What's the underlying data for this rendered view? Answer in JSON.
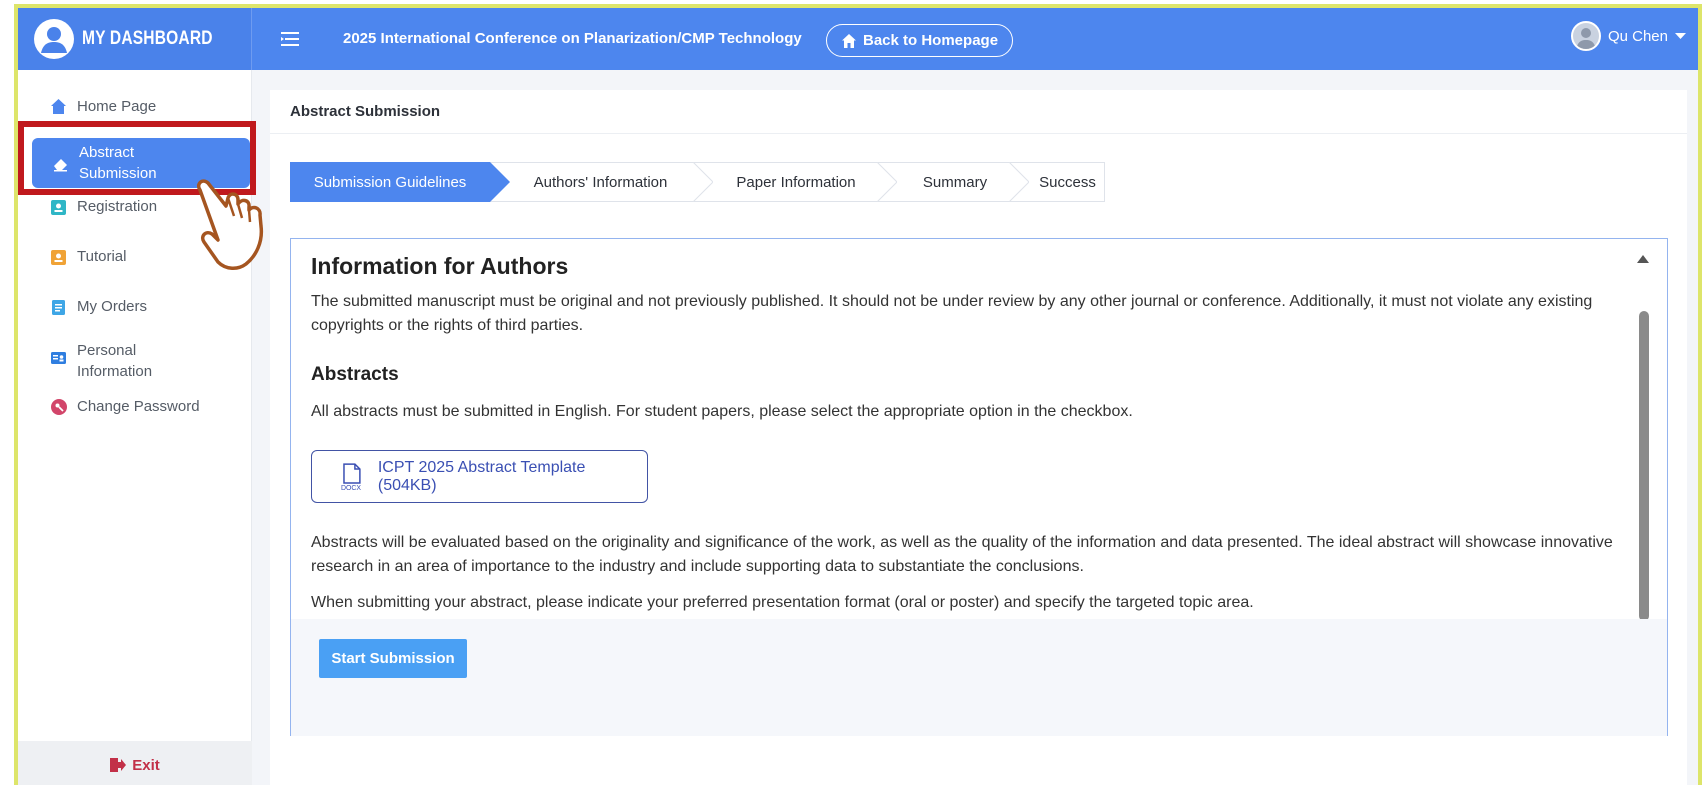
{
  "header": {
    "brand_title": "MY DASHBOARD",
    "conference_title": "2025 International Conference on Planarization/CMP Technology",
    "home_button": "Back to Homepage",
    "user_name": "Qu Chen"
  },
  "sidebar": {
    "items": [
      {
        "label": "Home Page",
        "icon": "home-icon"
      },
      {
        "label": "Abstract Submission",
        "icon": "eraser-icon"
      },
      {
        "label": "Registration",
        "icon": "badge-icon"
      },
      {
        "label": "Tutorial",
        "icon": "tutorial-icon"
      },
      {
        "label": "My Orders",
        "icon": "clipboard-icon"
      },
      {
        "label": "Personal Information",
        "icon": "id-card-icon"
      },
      {
        "label": "Change Password",
        "icon": "key-icon"
      }
    ],
    "exit_label": "Exit"
  },
  "main": {
    "card_title": "Abstract Submission",
    "steps": [
      "Submission Guidelines",
      "Authors' Information",
      "Paper Information",
      "Summary",
      "Success"
    ],
    "active_step": "Submission Guidelines",
    "heading": "Information for Authors",
    "paragraph1": "The submitted manuscript must be original and not previously published. It should not be under review by any other journal or conference. Additionally, it must not violate any existing copyrights or the rights of third parties.",
    "subheading": "Abstracts",
    "paragraph2": "All abstracts must be submitted in English. For student papers, please select the appropriate option in the checkbox.",
    "template_file_label": "ICPT 2025 Abstract Template (504KB)",
    "template_file_type": "DOCX",
    "paragraph3": "Abstracts will be evaluated based on the originality and significance of the work, as well as the quality of the information and data presented. The ideal abstract will showcase innovative research in an area of importance to the industry and include supporting data to substantiate the conclusions.",
    "paragraph4": "When submitting your abstract, please indicate your preferred presentation format (oral or poster) and specify the targeted topic area.",
    "start_button": "Start Submission"
  },
  "colors": {
    "primary": "#4d86ee",
    "highlight_box": "#c0191d",
    "frame_border": "#dde56a",
    "start_button": "#4aa0f4"
  }
}
